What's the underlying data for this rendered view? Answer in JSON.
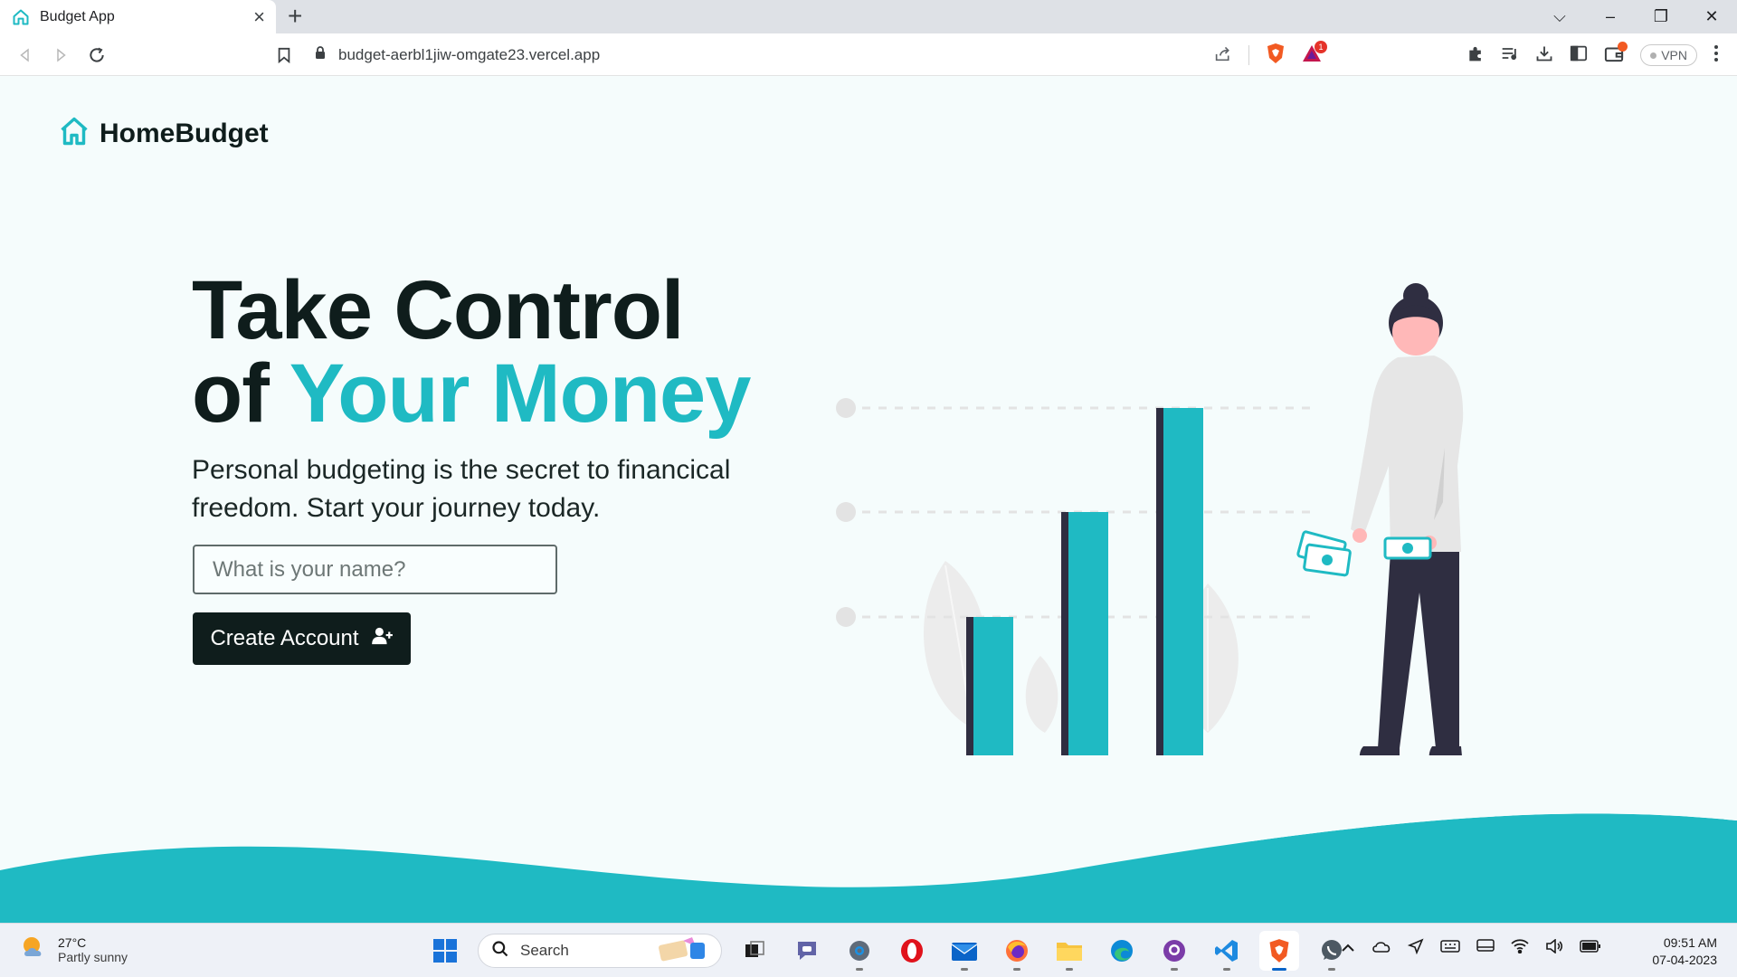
{
  "browser": {
    "tab_title": "Budget App",
    "url": "budget-aerbl1jiw-omgate23.vercel.app",
    "shields_badge": "1",
    "vpn_label": "VPN",
    "icons": [
      "home-icon",
      "close-icon",
      "plus-icon",
      "back-icon",
      "forward-icon",
      "reload-icon",
      "bookmark-icon",
      "lock-icon",
      "share-icon",
      "brave-shield-icon",
      "brave-rewards-icon",
      "puzzle-icon",
      "playlist-icon",
      "download-icon",
      "sidebar-icon",
      "wallet-icon",
      "menu-icon"
    ]
  },
  "page": {
    "logo_text": "HomeBudget",
    "hero_line1": "Take Control",
    "hero_line2_prefix": "of ",
    "hero_line2_accent": "Your Money",
    "subtitle": "Personal budgeting is the secret to financical freedom. Start your journey today.",
    "name_placeholder": "What is your name?",
    "create_button_label": "Create Account",
    "colors": {
      "accent": "#1fbac3",
      "dark": "#0f1d1c",
      "background": "#f5fcfc"
    }
  },
  "taskbar": {
    "weather_temp": "27°C",
    "weather_condition": "Partly sunny",
    "search_label": "Search",
    "clock_time": "09:51 AM",
    "clock_date": "07-04-2023",
    "apps": [
      "windows-start-icon",
      "task-view-icon",
      "teams-chat-icon",
      "settings-icon",
      "opera-icon",
      "mail-icon",
      "firefox-icon",
      "file-explorer-icon",
      "edge-icon",
      "github-desktop-icon",
      "vscode-icon",
      "brave-icon",
      "whatsapp-icon"
    ]
  }
}
